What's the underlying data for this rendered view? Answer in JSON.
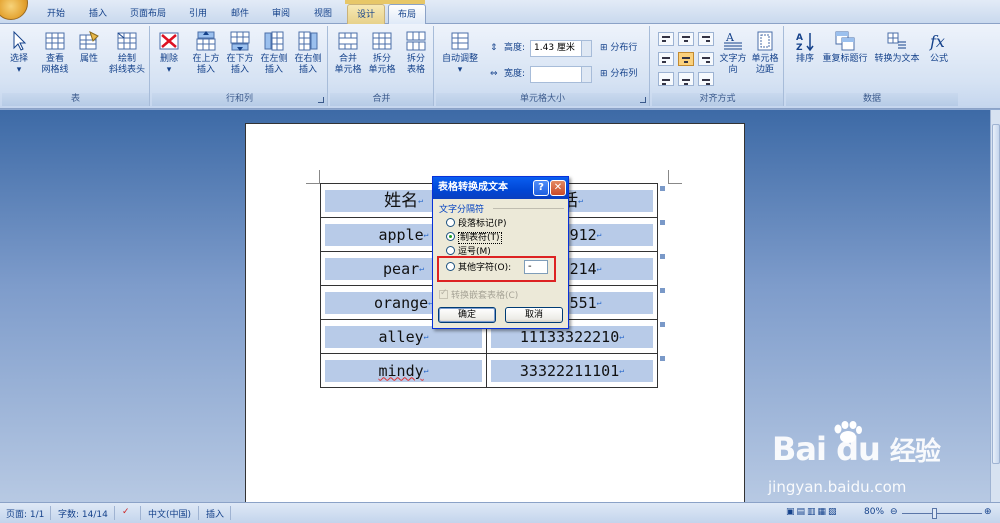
{
  "tabs": [
    {
      "label": "开始",
      "state": "normal"
    },
    {
      "label": "插入",
      "state": "normal"
    },
    {
      "label": "页面布局",
      "state": "normal"
    },
    {
      "label": "引用",
      "state": "normal"
    },
    {
      "label": "邮件",
      "state": "normal"
    },
    {
      "label": "审阅",
      "state": "normal"
    },
    {
      "label": "视图",
      "state": "normal"
    },
    {
      "label": "设计",
      "state": "contextual"
    },
    {
      "label": "布局",
      "state": "active"
    }
  ],
  "ribbon": {
    "groups": {
      "table": "表",
      "rows_cols": "行和列",
      "merge": "合并",
      "cell_size": "单元格大小",
      "alignment": "对齐方式",
      "data": "数据"
    },
    "buttons": {
      "select": "选择",
      "view_grid": "查看\n网格线",
      "properties": "属性",
      "draw_diag": "绘制\n斜线表头",
      "delete": "删除",
      "insert_above": "在上方\n插入",
      "insert_below": "在下方\n插入",
      "insert_left": "在左侧\n插入",
      "insert_right": "在右侧\n插入",
      "merge_cells": "合并\n单元格",
      "split_cells": "拆分\n单元格",
      "split_table": "拆分\n表格",
      "autofit": "自动调整",
      "height_label": "高度:",
      "height_value": "1.43 厘米",
      "width_label": "宽度:",
      "width_value": "",
      "distribute_rows": "分布行",
      "distribute_cols": "分布列",
      "text_direction": "文字方向",
      "cell_margins": "单元格\n边距",
      "sort": "排序",
      "repeat_header": "重复标题行",
      "convert_text": "转换为文本",
      "formula": "公式"
    }
  },
  "table": {
    "rows": [
      {
        "name": "姓名",
        "phone": "话"
      },
      {
        "name": "apple",
        "phone": "678912"
      },
      {
        "name": "pear",
        "phone": "456214"
      },
      {
        "name": "orange",
        "phone": "344551"
      },
      {
        "name": "alley",
        "phone": "11133322210"
      },
      {
        "name": "mindy",
        "phone": "33322211101"
      }
    ],
    "para_mark": "↵"
  },
  "dialog": {
    "title": "表格转换成文本",
    "help": "?",
    "close": "✕",
    "section": "文字分隔符",
    "options": [
      {
        "label": "段落标记(P)",
        "selected": false
      },
      {
        "label": "制表符(T)",
        "selected": true
      },
      {
        "label": "逗号(M)",
        "selected": false
      },
      {
        "label": "其他字符(O):",
        "selected": false
      }
    ],
    "other_char": "-",
    "nested_label": "转换嵌套表格(C)",
    "ok": "确定",
    "cancel": "取消"
  },
  "status": {
    "page": "页面: 1/1",
    "words": "字数: 14/14",
    "language": "中文(中国)",
    "mode": "插入",
    "zoom": "80%"
  },
  "watermark": {
    "brand": "Bai",
    "brand2": "du",
    "cn": "经验",
    "url": "jingyan.baidu.com"
  },
  "colors": {
    "ribbon_bg": "#d5e2f3",
    "dialog_title": "#0046d5",
    "cell_highlight": "#b8cbe8",
    "focus_red": "#dd2222"
  }
}
